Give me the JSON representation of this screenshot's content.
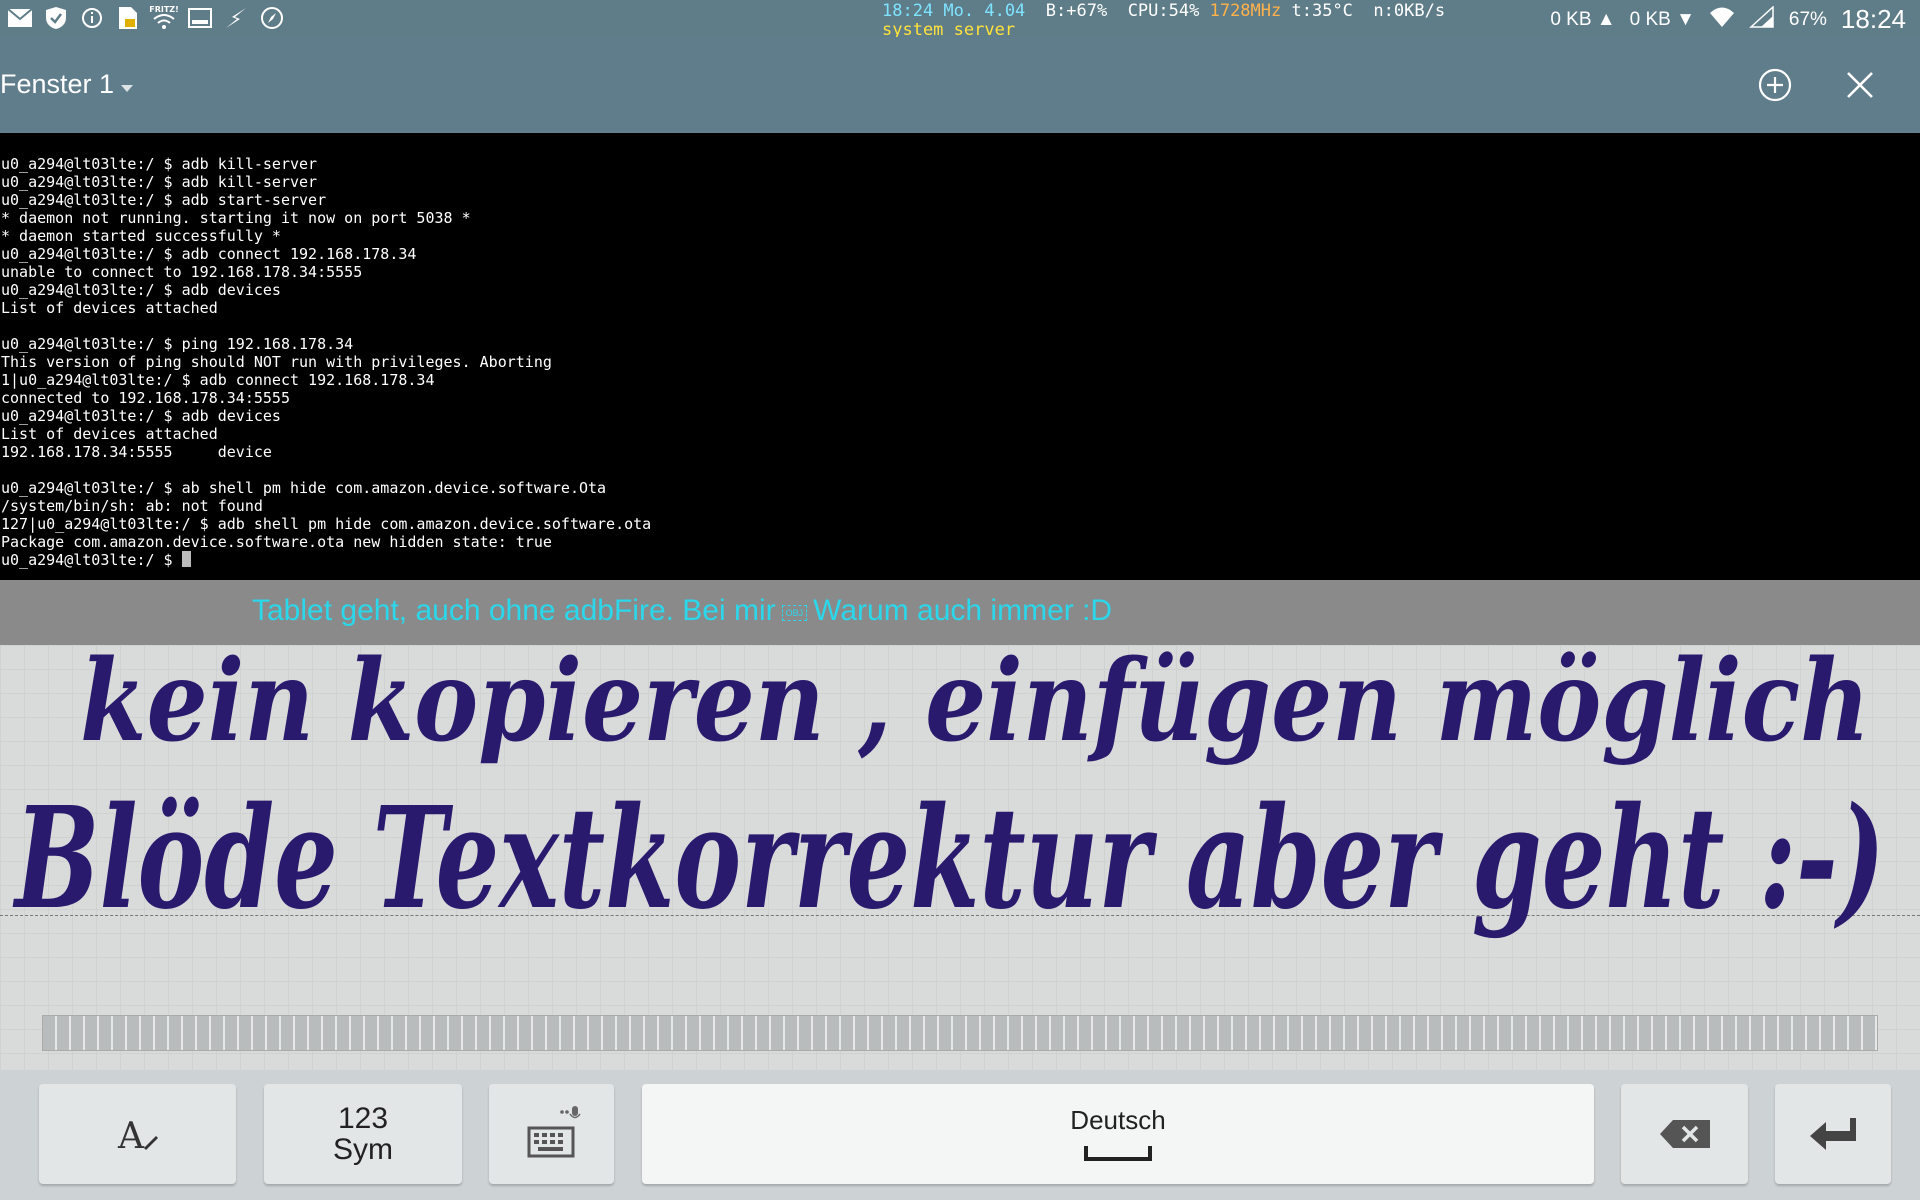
{
  "status_bar": {
    "icons": [
      "mail-icon",
      "shield-check-icon",
      "info-icon",
      "file-lock-icon",
      "wifi-fritz-icon",
      "image-icon",
      "flash-icon",
      "compass-icon"
    ],
    "fritz_label": "FRITZ!",
    "monitor_time": "18:24 Mo. 4.04",
    "battery_delta": "B:+67%",
    "cpu": "CPU:54%",
    "cpu_freq": "1728MHz",
    "temperature": "t:35°C",
    "net": "n:0KB/s",
    "process": "system_server",
    "upload": "0 KB ▲",
    "download": "0 KB ▼",
    "battery": "67%",
    "clock": "18:24"
  },
  "window_bar": {
    "title": "Fenster 1",
    "add_button": "add-window",
    "close_button": "close-window"
  },
  "terminal": {
    "lines": [
      "u0_a294@lt03lte:/ $ adb kill-server",
      "u0_a294@lt03lte:/ $ adb kill-server",
      "u0_a294@lt03lte:/ $ adb start-server",
      "* daemon not running. starting it now on port 5038 *",
      "* daemon started successfully *",
      "u0_a294@lt03lte:/ $ adb connect 192.168.178.34",
      "unable to connect to 192.168.178.34:5555",
      "u0_a294@lt03lte:/ $ adb devices",
      "List of devices attached",
      "",
      "u0_a294@lt03lte:/ $ ping 192.168.178.34",
      "This version of ping should NOT run with privileges. Aborting",
      "1|u0_a294@lt03lte:/ $ adb connect 192.168.178.34",
      "connected to 192.168.178.34:5555",
      "u0_a294@lt03lte:/ $ adb devices",
      "List of devices attached",
      "192.168.178.34:5555     device",
      "",
      "u0_a294@lt03lte:/ $ ab shell pm hide com.amazon.device.software.Ota",
      "/system/bin/sh: ab: not found",
      "127|u0_a294@lt03lte:/ $ adb shell pm hide com.amazon.device.software.ota",
      "Package com.amazon.device.software.ota new hidden state: true"
    ],
    "prompt": "u0_a294@lt03lte:/ $ "
  },
  "suggestion": {
    "text_before": "Tablet geht, auch ohne adbFire. Bei mir",
    "obj_glyph": "OBJ",
    "text_after": "Warum auch immer :D"
  },
  "handwriting": {
    "line1": "kein kopieren , einfügen möglich",
    "line2": "Blöde Textkorrektur aber geht :-)",
    "ink_color": "#2a1a6e"
  },
  "keyboard": {
    "handwriting_key_icon": "handwriting-icon",
    "sym_line1": "123",
    "sym_line2": "Sym",
    "keyboard_key_icon": "keyboard-icon",
    "space_label": "Deutsch",
    "backspace_icon": "backspace-icon",
    "enter_icon": "enter-icon"
  }
}
